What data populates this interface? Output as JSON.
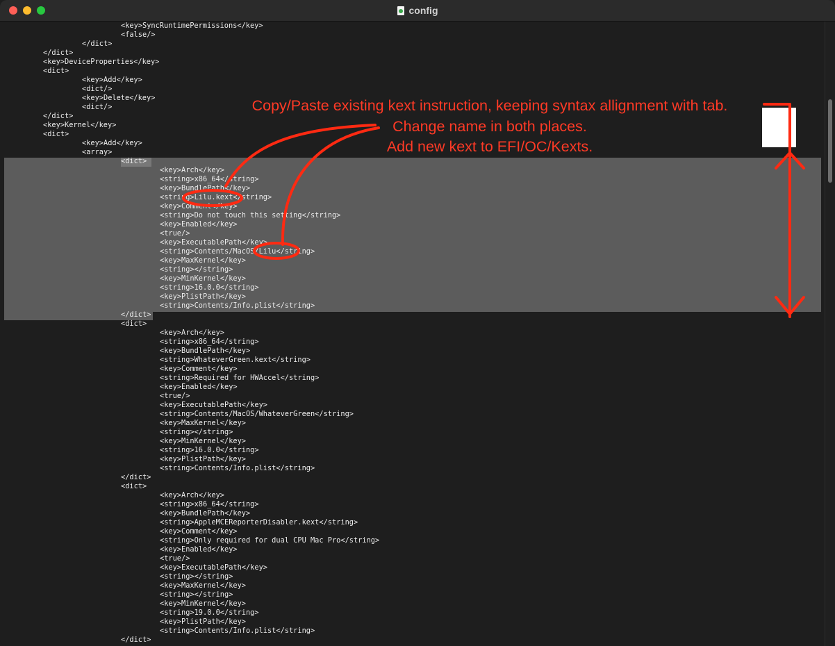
{
  "window": {
    "title": "config"
  },
  "annotation": {
    "lines": [
      "Copy/Paste existing kext instruction, keeping syntax allignment with tab.",
      "Change name in both places.",
      "Add new kext to EFI/OC/Kexts."
    ],
    "color": "#ff3a26"
  },
  "editor": {
    "lines": [
      "\t\t\t<key>SyncRuntimePermissions</key>",
      "\t\t\t<false/>",
      "\t\t</dict>",
      "\t</dict>",
      "\t<key>DeviceProperties</key>",
      "\t<dict>",
      "\t\t<key>Add</key>",
      "\t\t<dict/>",
      "\t\t<key>Delete</key>",
      "\t\t<dict/>",
      "\t</dict>",
      "\t<key>Kernel</key>",
      "\t<dict>",
      "\t\t<key>Add</key>",
      "\t\t<array>",
      "\t\t\t<dict>",
      "\t\t\t\t<key>Arch</key>",
      "\t\t\t\t<string>x86_64</string>",
      "\t\t\t\t<key>BundlePath</key>",
      "\t\t\t\t<string>Lilu.kext</string>",
      "\t\t\t\t<key>Comment</key>",
      "\t\t\t\t<string>Do not touch this setting</string>",
      "\t\t\t\t<key>Enabled</key>",
      "\t\t\t\t<true/>",
      "\t\t\t\t<key>ExecutablePath</key>",
      "\t\t\t\t<string>Contents/MacOS/Lilu</string>",
      "\t\t\t\t<key>MaxKernel</key>",
      "\t\t\t\t<string></string>",
      "\t\t\t\t<key>MinKernel</key>",
      "\t\t\t\t<string>16.0.0</string>",
      "\t\t\t\t<key>PlistPath</key>",
      "\t\t\t\t<string>Contents/Info.plist</string>",
      "\t\t\t</dict>",
      "\t\t\t<dict>",
      "\t\t\t\t<key>Arch</key>",
      "\t\t\t\t<string>x86_64</string>",
      "\t\t\t\t<key>BundlePath</key>",
      "\t\t\t\t<string>WhateverGreen.kext</string>",
      "\t\t\t\t<key>Comment</key>",
      "\t\t\t\t<string>Required for HWAccel</string>",
      "\t\t\t\t<key>Enabled</key>",
      "\t\t\t\t<true/>",
      "\t\t\t\t<key>ExecutablePath</key>",
      "\t\t\t\t<string>Contents/MacOS/WhateverGreen</string>",
      "\t\t\t\t<key>MaxKernel</key>",
      "\t\t\t\t<string></string>",
      "\t\t\t\t<key>MinKernel</key>",
      "\t\t\t\t<string>16.0.0</string>",
      "\t\t\t\t<key>PlistPath</key>",
      "\t\t\t\t<string>Contents/Info.plist</string>",
      "\t\t\t</dict>",
      "\t\t\t<dict>",
      "\t\t\t\t<key>Arch</key>",
      "\t\t\t\t<string>x86_64</string>",
      "\t\t\t\t<key>BundlePath</key>",
      "\t\t\t\t<string>AppleMCEReporterDisabler.kext</string>",
      "\t\t\t\t<key>Comment</key>",
      "\t\t\t\t<string>Only required for dual CPU Mac Pro</string>",
      "\t\t\t\t<key>Enabled</key>",
      "\t\t\t\t<true/>",
      "\t\t\t\t<key>ExecutablePath</key>",
      "\t\t\t\t<string></string>",
      "\t\t\t\t<key>MaxKernel</key>",
      "\t\t\t\t<string></string>",
      "\t\t\t\t<key>MinKernel</key>",
      "\t\t\t\t<string>19.0.0</string>",
      "\t\t\t\t<key>PlistPath</key>",
      "\t\t\t\t<string>Contents/Info.plist</string>",
      "\t\t\t</dict>"
    ]
  }
}
